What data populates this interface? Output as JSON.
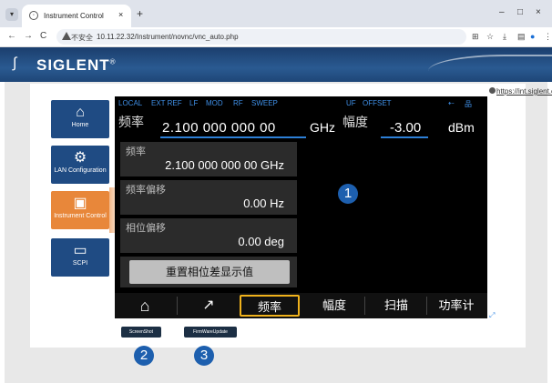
{
  "browser": {
    "tab_title": "Instrument Control",
    "tab_close": "×",
    "new_tab": "+",
    "insecure_label": "不安全",
    "url": "10.11.22.32/Instrument/novnc/vnc_auto.php",
    "nav_back": "←",
    "nav_forward": "→",
    "nav_reload": "C",
    "window_minimize": "–",
    "window_maximize": "□",
    "window_close": "×"
  },
  "header": {
    "brand": "SIGLENT",
    "registered": "®"
  },
  "link": {
    "text": "https://int.siglent.com/"
  },
  "sidebar": {
    "items": [
      {
        "label": "Home",
        "icon": "home-icon"
      },
      {
        "label": "LAN Configuration",
        "icon": "gear-icon"
      },
      {
        "label": "Instrument Control",
        "icon": "monitor-icon"
      },
      {
        "label": "SCPI",
        "icon": "terminal-icon"
      }
    ]
  },
  "instrument": {
    "status": [
      "LOCAL",
      "EXT REF",
      "LF",
      "MOD",
      "RF",
      "SWEEP",
      "UF",
      "OFFSET"
    ],
    "frequency_label": "频率",
    "frequency_value": "2.100 000 000 00",
    "frequency_unit": "GHz",
    "amplitude_label": "幅度",
    "amplitude_value": "-3.00",
    "amplitude_unit": "dBm",
    "cells": [
      {
        "label": "频率",
        "value": "2.100 000 000 00 GHz"
      },
      {
        "label": "频率偏移",
        "value": "0.00 Hz"
      },
      {
        "label": "相位偏移",
        "value": "0.00 deg"
      }
    ],
    "reset_button": "重置相位差显示值",
    "softkeys": [
      "频率",
      "幅度",
      "扫描",
      "功率计"
    ]
  },
  "buttons": {
    "screenshot": "ScreenShot",
    "firmware_update": "FirmWareUpdate"
  },
  "markers": [
    "1",
    "2",
    "3"
  ],
  "colors": {
    "brand_blue": "#1f4b83",
    "active_orange": "#e8873a",
    "softkey_highlight": "#f0b21c",
    "marker_blue": "#1d5fae"
  }
}
